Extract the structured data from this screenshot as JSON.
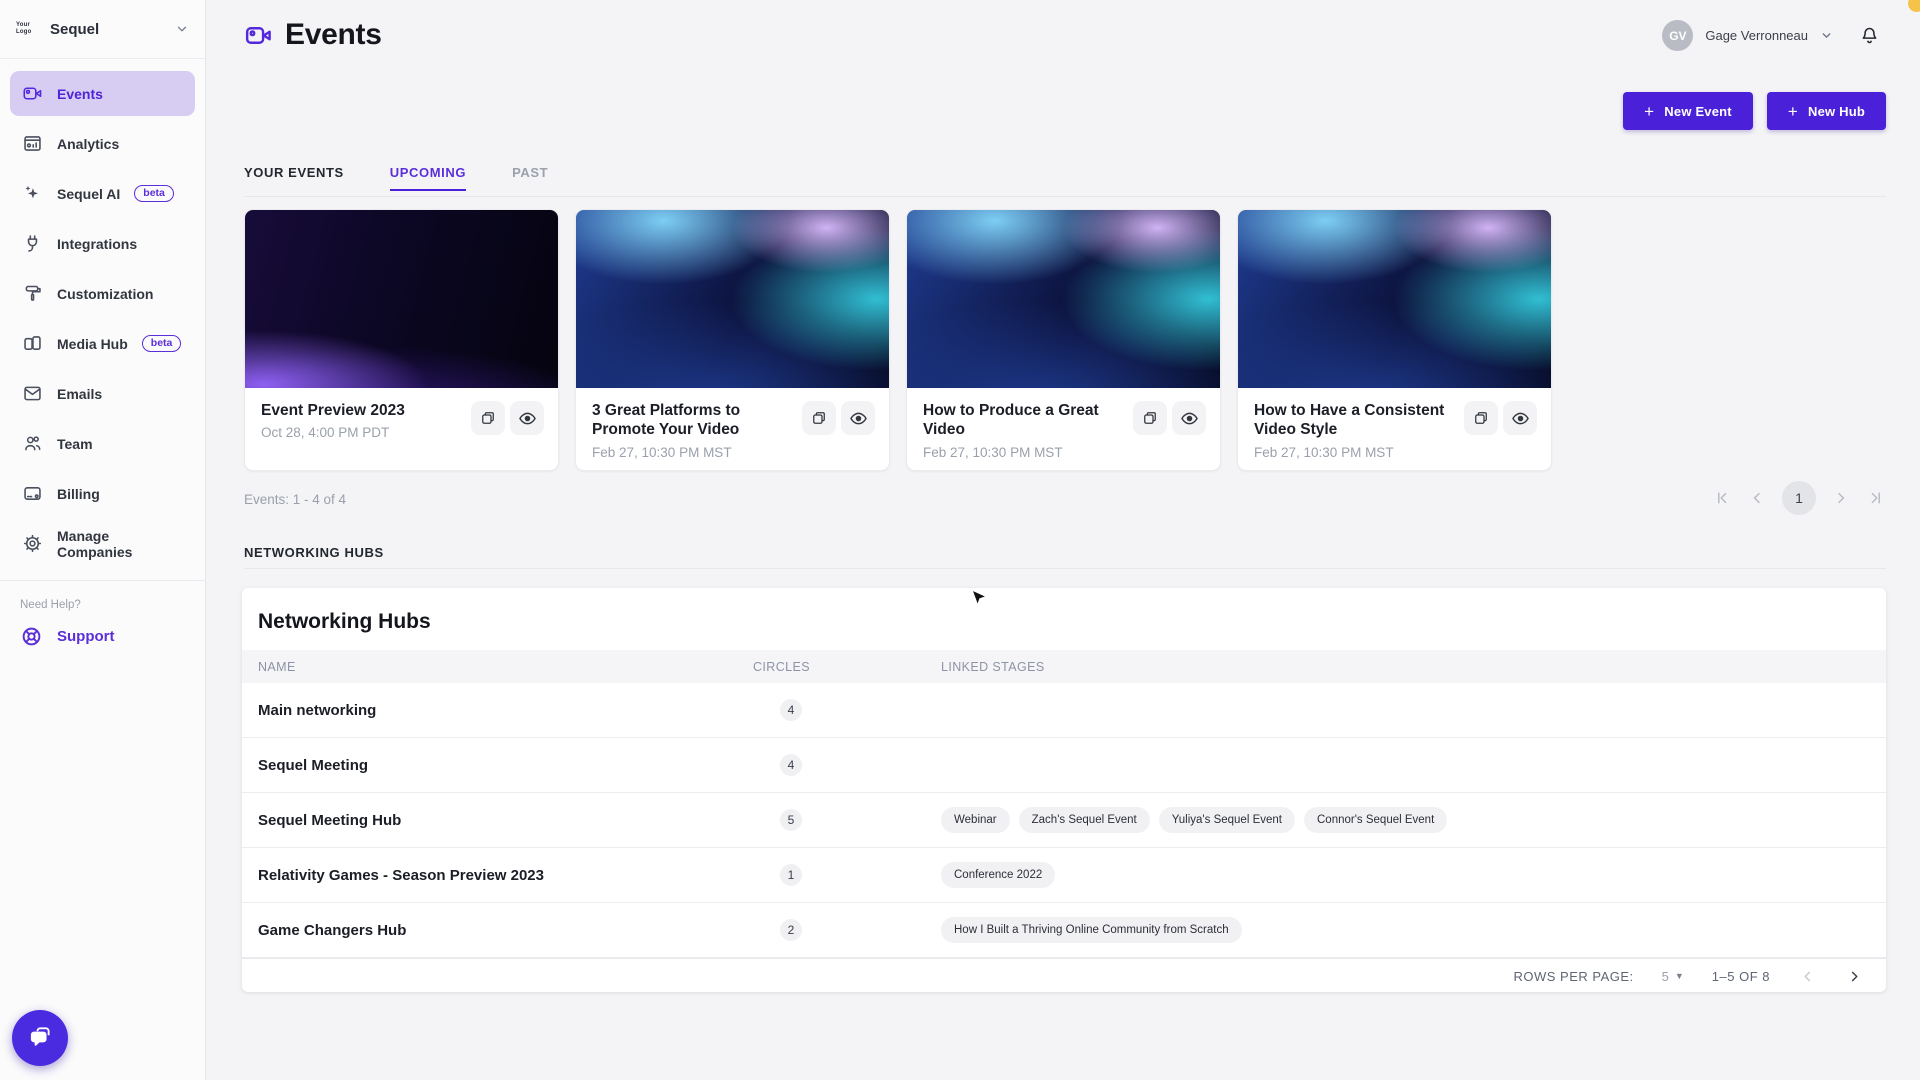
{
  "brand": {
    "logo_label": "Your Logo",
    "workspace": "Sequel"
  },
  "sidebar": {
    "items": [
      {
        "label": "Events",
        "icon": "video-icon",
        "active": true
      },
      {
        "label": "Analytics",
        "icon": "analytics-icon"
      },
      {
        "label": "Sequel AI",
        "icon": "sparkles-icon",
        "badge": "beta"
      },
      {
        "label": "Integrations",
        "icon": "plug-icon"
      },
      {
        "label": "Customization",
        "icon": "paint-roller-icon"
      },
      {
        "label": "Media Hub",
        "icon": "devices-icon",
        "badge": "beta"
      },
      {
        "label": "Emails",
        "icon": "envelope-icon"
      },
      {
        "label": "Team",
        "icon": "people-icon"
      },
      {
        "label": "Billing",
        "icon": "credit-card-icon"
      },
      {
        "label": "Manage Companies",
        "icon": "gear-icon"
      }
    ],
    "help_label": "Need Help?",
    "support_label": "Support"
  },
  "header": {
    "title": "Events",
    "user_initials": "GV",
    "user_name": "Gage Verronneau"
  },
  "actions": {
    "new_event": "New Event",
    "new_hub": "New Hub",
    "plus": "+"
  },
  "tabs": {
    "section_label": "YOUR EVENTS",
    "upcoming": "UPCOMING",
    "past": "PAST"
  },
  "events": {
    "cards": [
      {
        "title": "Event Preview 2023",
        "date": "Oct 28, 4:00 PM PDT"
      },
      {
        "title": "3 Great Platforms to Promote Your Video",
        "date": "Feb 27, 10:30 PM MST"
      },
      {
        "title": "How to Produce a Great Video",
        "date": "Feb 27, 10:30 PM MST"
      },
      {
        "title": "How to Have a Consistent Video Style",
        "date": "Feb 27, 10:30 PM MST"
      }
    ],
    "count_text": "Events: 1 - 4 of 4",
    "page": "1"
  },
  "hubs": {
    "section_label": "NETWORKING HUBS",
    "title": "Networking Hubs",
    "columns": {
      "name": "NAME",
      "circles": "CIRCLES",
      "stages": "LINKED STAGES"
    },
    "rows": [
      {
        "name": "Main networking",
        "circles": "4",
        "stages": []
      },
      {
        "name": "Sequel Meeting",
        "circles": "4",
        "stages": []
      },
      {
        "name": "Sequel Meeting Hub",
        "circles": "5",
        "stages": [
          "Webinar",
          "Zach's Sequel Event",
          "Yuliya's Sequel Event",
          "Connor's Sequel Event"
        ]
      },
      {
        "name": "Relativity Games - Season Preview 2023",
        "circles": "1",
        "stages": [
          "Conference 2022"
        ]
      },
      {
        "name": "Game Changers Hub",
        "circles": "2",
        "stages": [
          "How I Built a Thriving Online Community from Scratch"
        ]
      }
    ],
    "footer": {
      "rows_per_page_label": "ROWS PER PAGE:",
      "rows_per_page": "5",
      "range": "1–5 OF 8"
    }
  },
  "colors": {
    "accent": "#4a21d9",
    "accent_light": "#d7cdf2",
    "page_bg": "#f4f4f6"
  }
}
